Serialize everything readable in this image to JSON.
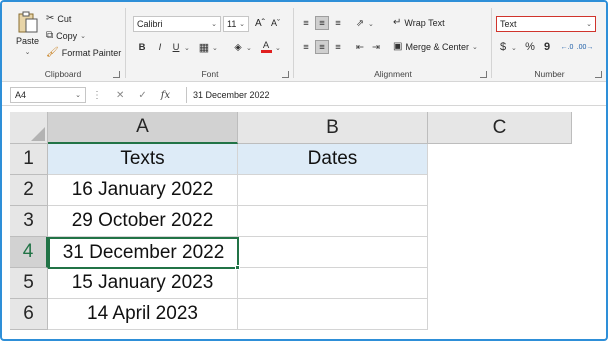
{
  "ribbon": {
    "clipboard": {
      "paste_label": "Paste",
      "cut_label": "Cut",
      "copy_label": "Copy",
      "format_painter_label": "Format Painter",
      "group_label": "Clipboard"
    },
    "font": {
      "font_name": "Calibri",
      "font_size": "11",
      "bold": "B",
      "italic": "I",
      "underline": "U",
      "group_label": "Font"
    },
    "alignment": {
      "wrap_text_label": "Wrap Text",
      "merge_center_label": "Merge & Center",
      "group_label": "Alignment"
    },
    "number": {
      "format_value": "Text",
      "currency_symbol": "$",
      "percent_symbol": "%",
      "comma_symbol": "9",
      "group_label": "Number"
    }
  },
  "formula_bar": {
    "name_box": "A4",
    "fx_label": "fx",
    "content": "31 December 2022"
  },
  "sheet": {
    "columns": [
      "A",
      "B",
      "C"
    ],
    "rows": [
      "1",
      "2",
      "3",
      "4",
      "5",
      "6"
    ],
    "cells": {
      "A1": "Texts",
      "B1": "Dates",
      "A2": "16 January 2022",
      "A3": "29 October 2022",
      "A4": "31 December 2022",
      "A5": "15 January 2023",
      "A6": "14 April 2023"
    },
    "header_fill": "#ddebf7",
    "selection_color": "#217346"
  }
}
